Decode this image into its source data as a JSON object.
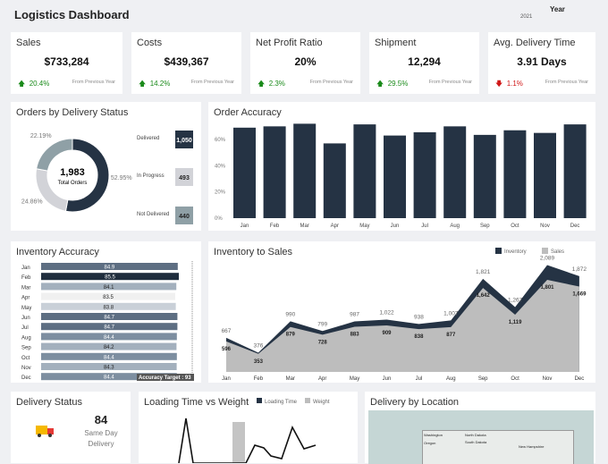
{
  "header": {
    "title": "Logistics Dashboard",
    "year_label": "Year",
    "year_value": "2021"
  },
  "kpis": [
    {
      "label": "Sales",
      "value": "$733,284",
      "change": "20.4%",
      "direction": "up",
      "note": "From Previous Year"
    },
    {
      "label": "Costs",
      "value": "$439,367",
      "change": "14.2%",
      "direction": "up",
      "note": "From Previous Year"
    },
    {
      "label": "Net Profit Ratio",
      "value": "20%",
      "change": "2.3%",
      "direction": "up",
      "note": "From Previous Year"
    },
    {
      "label": "Shipment",
      "value": "12,294",
      "change": "29.5%",
      "direction": "up",
      "note": "From Previous Year"
    },
    {
      "label": "Avg. Delivery Time",
      "value": "3.91 Days",
      "change": "1.1%",
      "direction": "down",
      "note": "From Previous Year"
    }
  ],
  "colors": {
    "dark": "#253344",
    "mid": "#8fa0a6",
    "light": "#d2d3d8",
    "up": "#1a8a1a",
    "down": "#d01818",
    "sales_area": "#bdbdbd"
  },
  "chart_data": [
    {
      "type": "pie",
      "title": "Orders by Delivery Status",
      "center_value": "1,983",
      "center_label": "Total Orders",
      "slices": [
        {
          "label": "Delivered",
          "value": 1050,
          "display": "1,050",
          "percent": "52.95%"
        },
        {
          "label": "In Progress",
          "value": 493,
          "display": "493",
          "percent": "24.86%"
        },
        {
          "label": "Not Delivered",
          "value": 440,
          "display": "440",
          "percent": "22.19%"
        }
      ]
    },
    {
      "type": "bar",
      "title": "Order Accuracy",
      "categories": [
        "Jan",
        "Feb",
        "Mar",
        "Apr",
        "May",
        "Jun",
        "Jul",
        "Aug",
        "Sep",
        "Oct",
        "Nov",
        "Dec"
      ],
      "values": [
        69,
        70,
        72,
        57,
        71.5,
        63,
        65.5,
        70,
        63.5,
        67,
        65,
        71.5
      ],
      "yticks": [
        "0%",
        "20%",
        "40%",
        "60%"
      ],
      "ylim": [
        0,
        70
      ],
      "grid": false
    },
    {
      "type": "bar",
      "orientation": "horizontal",
      "title": "Inventory Accuracy",
      "categories": [
        "Jan",
        "Feb",
        "Mar",
        "Apr",
        "May",
        "Jun",
        "Jul",
        "Aug",
        "Sep",
        "Oct",
        "Nov",
        "Dec"
      ],
      "values": [
        84.9,
        85.5,
        84.1,
        83.5,
        83.8,
        84.7,
        84.7,
        84.4,
        84.2,
        84.4,
        84.3,
        84.4
      ],
      "reference_line": {
        "label": "Accuracy Target : 93",
        "value": 93
      }
    },
    {
      "type": "area",
      "title": "Inventory to Sales",
      "categories": [
        "Jan",
        "Feb",
        "Mar",
        "Apr",
        "May",
        "Jun",
        "Jul",
        "Aug",
        "Sep",
        "Oct",
        "Nov",
        "Dec"
      ],
      "legend_position": "top-right",
      "series": [
        {
          "name": "Inventory",
          "values": [
            667,
            376,
            990,
            799,
            987,
            1022,
            938,
            1007,
            1821,
            1267,
            2089,
            1872
          ],
          "labels": [
            "667",
            "376",
            "990",
            "799",
            "987",
            "1,022",
            "938",
            "1,007",
            "1,821",
            "1,267",
            "2,089",
            "1,872"
          ]
        },
        {
          "name": "Sales",
          "values": [
            596,
            353,
            879,
            728,
            883,
            909,
            838,
            877,
            1642,
            1119,
            1801,
            1669
          ],
          "labels": [
            "596",
            "353",
            "879",
            "728",
            "883",
            "909",
            "838",
            "877",
            "1,642",
            "1,119",
            "1,801",
            "1,669"
          ]
        }
      ]
    },
    {
      "type": "line",
      "title": "Loading Time vs Weight",
      "series": [
        {
          "name": "Loading Time"
        },
        {
          "name": "Weight"
        }
      ]
    }
  ],
  "delivery_status": {
    "title": "Delivery Status",
    "value": "84",
    "label1": "Same Day",
    "label2": "Delivery"
  },
  "map": {
    "title": "Delivery by Location",
    "states": [
      "Washington",
      "Oregon",
      "North Dakota",
      "South Dakota",
      "New Hampshire"
    ]
  }
}
